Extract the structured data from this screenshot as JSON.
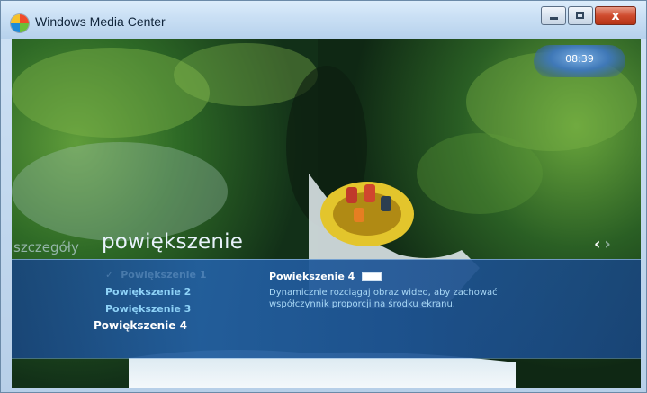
{
  "window": {
    "title": "Windows Media Center",
    "close_glyph": "x"
  },
  "clock": {
    "time": "08:39"
  },
  "header": {
    "previous_heading": "szczegóły",
    "heading": "powiększenie"
  },
  "nav": {
    "left_glyph": "‹",
    "right_glyph": "›"
  },
  "options": {
    "items": [
      {
        "label": "Powiększenie 1",
        "state": "checked-scrolled"
      },
      {
        "label": "Powiększenie 2"
      },
      {
        "label": "Powiększenie 3"
      },
      {
        "label": "Powiększenie 4",
        "state": "focused"
      }
    ],
    "check_glyph": "✓"
  },
  "detail": {
    "title": "Powiększenie 4",
    "description": "Dynamicznie rozciągaj obraz wideo, aby zachować współczynnik proporcji na środku ekranu.",
    "icon": "widescreen-aspect-icon"
  },
  "colors": {
    "panel_blue": "#235fa0",
    "option_text": "#8ed2f7",
    "description_text": "#a9d8f6",
    "close_button": "#cf4b2e"
  }
}
